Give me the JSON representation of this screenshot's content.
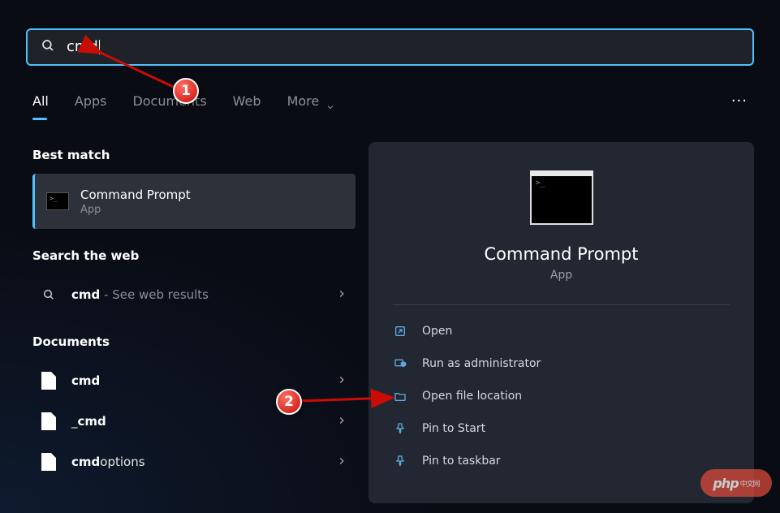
{
  "search": {
    "query": "cmd"
  },
  "tabs": {
    "items": [
      "All",
      "Apps",
      "Documents",
      "Web",
      "More"
    ],
    "active_index": 0
  },
  "left": {
    "best_match_heading": "Best match",
    "best_match": {
      "title": "Command Prompt",
      "subtitle": "App"
    },
    "web_heading": "Search the web",
    "web_item": {
      "bold": "cmd",
      "suffix": " - See web results"
    },
    "docs_heading": "Documents",
    "docs": [
      {
        "bold": "cmd",
        "rest": ""
      },
      {
        "bold": "",
        "rest": "_",
        "bold2": "cmd"
      },
      {
        "bold": "cmd",
        "rest": "options"
      }
    ]
  },
  "right": {
    "title": "Command Prompt",
    "subtitle": "App",
    "actions": [
      {
        "label": "Open",
        "icon": "open-icon"
      },
      {
        "label": "Run as administrator",
        "icon": "admin-icon"
      },
      {
        "label": "Open file location",
        "icon": "folder-icon"
      },
      {
        "label": "Pin to Start",
        "icon": "pin-start-icon"
      },
      {
        "label": "Pin to taskbar",
        "icon": "pin-taskbar-icon"
      }
    ]
  },
  "annotations": {
    "marker1": "1",
    "marker2": "2"
  },
  "watermark": {
    "main": "php",
    "sub": "中文网"
  }
}
